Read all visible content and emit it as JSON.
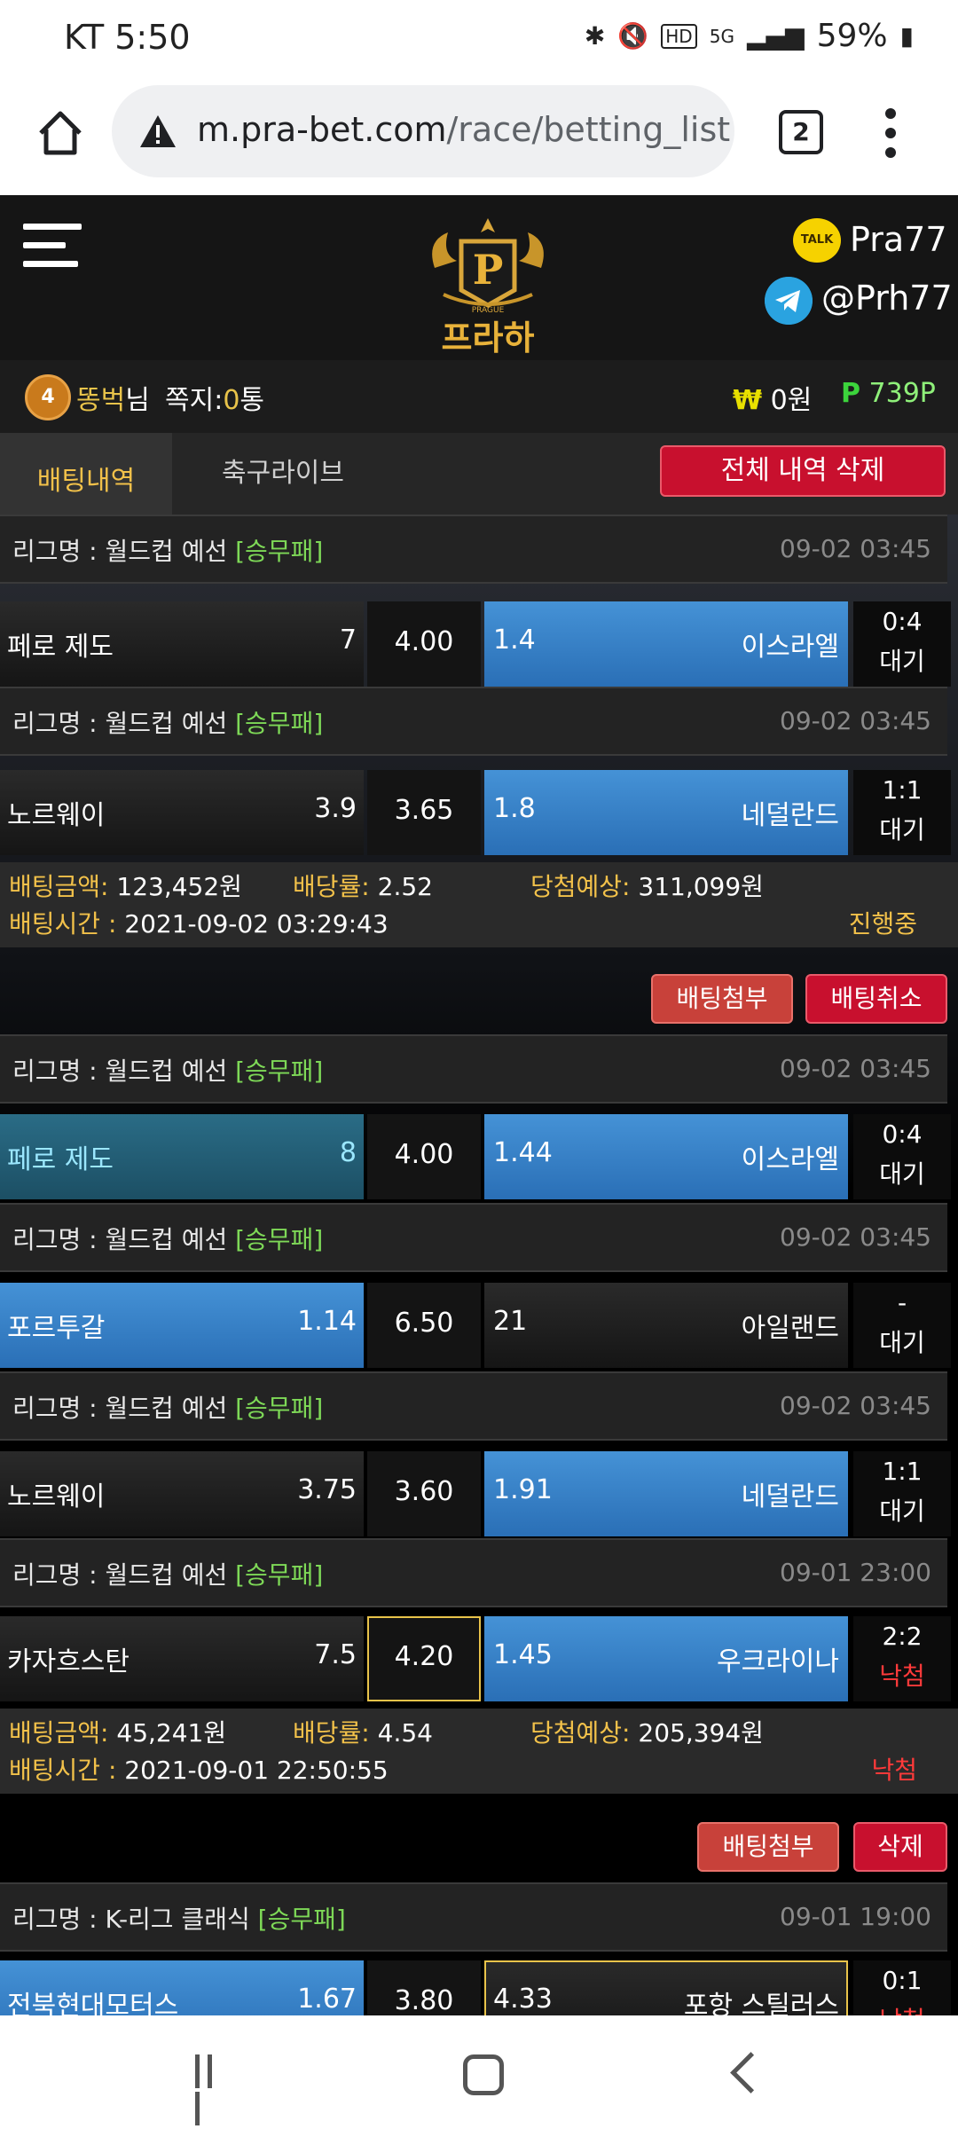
{
  "status": {
    "carrier_time": "KT 5:50",
    "battery": "59%"
  },
  "browser": {
    "url_domain": "m.pra-bet.com",
    "url_path": "/race/betting_list",
    "tab_count": "2"
  },
  "site": {
    "brand": "프라하",
    "brand_sub": "PRAGUE",
    "kakao_id": "Pra77",
    "telegram_id": "@Prh77",
    "kakao_badge": "TALK"
  },
  "user": {
    "level": "4",
    "name": "똥벅",
    "name_suffix": "님",
    "memo_label": "쪽지:",
    "memo_count": "0",
    "memo_unit": "통",
    "money_symbol": "₩",
    "money": "0원",
    "point_symbol": "P",
    "points": "739P"
  },
  "tabs": {
    "betting_history": "배팅내역",
    "soccer_live": "축구라이브",
    "delete_all": "전체 내역 삭제"
  },
  "league_prefix": "리그명 : ",
  "bets": [
    {
      "matches": [
        {
          "league": "월드컵 예선",
          "market": "[승무패]",
          "time": "09-02 03:45",
          "home": "페로 제도",
          "home_odds": "7",
          "draw": "4.00",
          "away_odds": "1.4",
          "away": "이스라엘",
          "score": "0:4",
          "status": "대기"
        },
        {
          "league": "월드컵 예선",
          "market": "[승무패]",
          "time": "09-02 03:45",
          "home": "노르웨이",
          "home_odds": "3.9",
          "draw": "3.65",
          "away_odds": "1.8",
          "away": "네덜란드",
          "score": "1:1",
          "status": "대기"
        }
      ],
      "summary": {
        "amount_label": "배팅금액:",
        "amount": "123,452원",
        "rate_label": "배당률:",
        "rate": "2.52",
        "expect_label": "당첨예상:",
        "expect": "311,099원",
        "time_label": "배팅시간 :",
        "time": "2021-09-02 03:29:43",
        "state": "진행중"
      },
      "buttons": {
        "attach": "배팅첨부",
        "action": "배팅취소"
      }
    },
    {
      "matches": [
        {
          "league": "월드컵 예선",
          "market": "[승무패]",
          "time": "09-02 03:45",
          "home": "페로 제도",
          "home_odds": "8",
          "draw": "4.00",
          "away_odds": "1.44",
          "away": "이스라엘",
          "score": "0:4",
          "status": "대기"
        },
        {
          "league": "월드컵 예선",
          "market": "[승무패]",
          "time": "09-02 03:45",
          "home": "포르투갈",
          "home_odds": "1.14",
          "draw": "6.50",
          "away_odds": "21",
          "away": "아일랜드",
          "score": "-",
          "status": "대기"
        },
        {
          "league": "월드컵 예선",
          "market": "[승무패]",
          "time": "09-02 03:45",
          "home": "노르웨이",
          "home_odds": "3.75",
          "draw": "3.60",
          "away_odds": "1.91",
          "away": "네덜란드",
          "score": "1:1",
          "status": "대기"
        },
        {
          "league": "월드컵 예선",
          "market": "[승무패]",
          "time": "09-01 23:00",
          "home": "카자흐스탄",
          "home_odds": "7.5",
          "draw": "4.20",
          "away_odds": "1.45",
          "away": "우크라이나",
          "score": "2:2",
          "status": "낙첨"
        }
      ],
      "summary": {
        "amount_label": "배팅금액:",
        "amount": "45,241원",
        "rate_label": "배당률:",
        "rate": "4.54",
        "expect_label": "당첨예상:",
        "expect": "205,394원",
        "time_label": "배팅시간 :",
        "time": "2021-09-01 22:50:55",
        "state": "낙첨"
      },
      "buttons": {
        "attach": "배팅첨부",
        "action": "삭제"
      }
    },
    {
      "matches": [
        {
          "league": "K-리그 클래식",
          "market": "[승무패]",
          "time": "09-01 19:00",
          "home": "전북현대모터스",
          "home_odds": "1.67",
          "draw": "3.80",
          "away_odds": "4.33",
          "away": "포항 스틸러스",
          "score": "0:1",
          "status": "낙첨"
        }
      ]
    }
  ]
}
